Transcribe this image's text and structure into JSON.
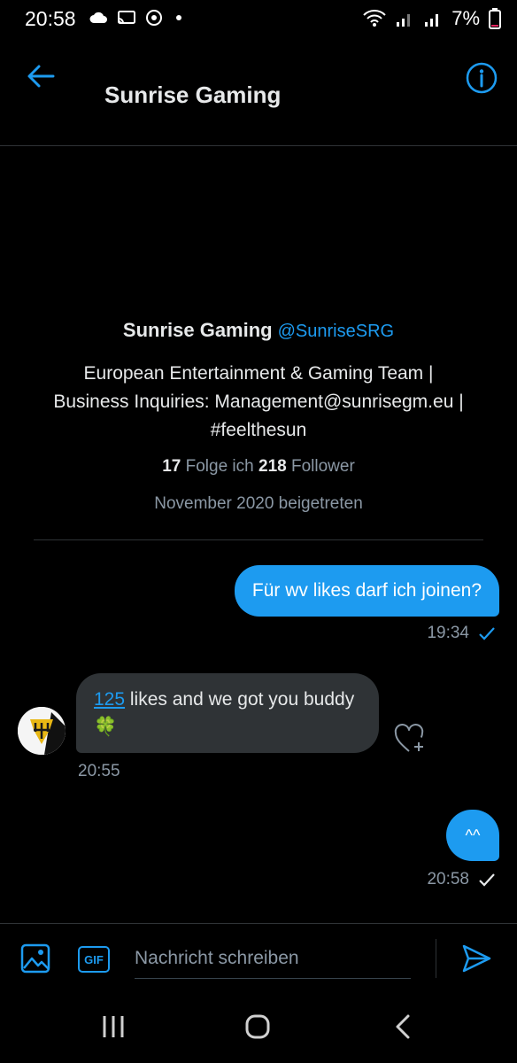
{
  "status_bar": {
    "time": "20:58",
    "battery": "7%"
  },
  "header": {
    "title": "Sunrise Gaming"
  },
  "profile": {
    "name": "Sunrise Gaming",
    "handle": "@SunriseSRG",
    "bio_line1": "European Entertainment & Gaming Team |",
    "bio_line2": "Business Inquiries: Management@sunrisegm.eu |",
    "bio_line3": "#feelthesun",
    "following_count": "17",
    "following_label": "Folge ich",
    "followers_count": "218",
    "followers_label": "Follower",
    "joined": "November 2020 beigetreten"
  },
  "messages": [
    {
      "text": "Für wv likes darf ich joinen?",
      "time": "19:34"
    },
    {
      "link": "125",
      "text_after_link": " likes and we got you buddy",
      "emoji": "🍀",
      "time": "20:55"
    },
    {
      "text": "^^",
      "time": "20:58"
    }
  ],
  "composer": {
    "placeholder": "Nachricht schreiben",
    "gif_label": "GIF"
  },
  "colors": {
    "accent": "#1d9bf0",
    "background": "#000000",
    "incoming_bubble": "#2f3336",
    "muted": "#8b98a5"
  }
}
